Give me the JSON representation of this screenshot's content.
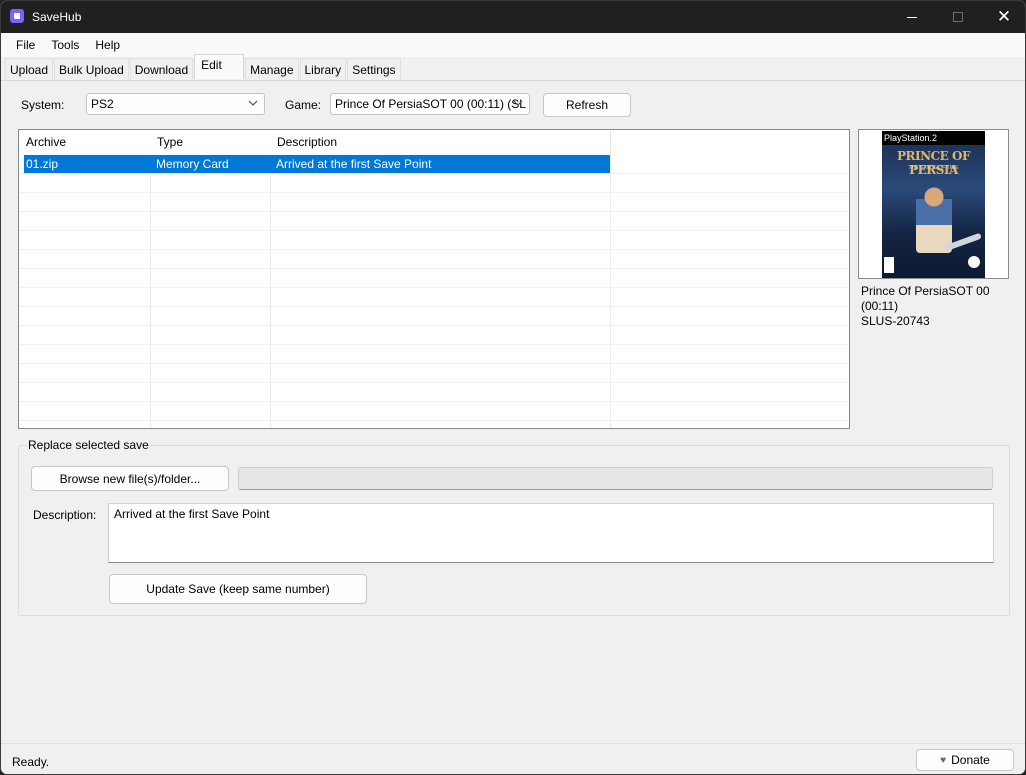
{
  "window": {
    "title": "SaveHub"
  },
  "menu": [
    "File",
    "Tools",
    "Help"
  ],
  "tabs": [
    "Upload",
    "Bulk Upload",
    "Download",
    "Edit",
    "Manage",
    "Library",
    "Settings"
  ],
  "active_tab": "Edit",
  "filters": {
    "system_label": "System:",
    "system_value": "PS2",
    "game_label": "Game:",
    "game_value": "Prince Of PersiaSOT 00 (00:11) (SL",
    "refresh_label": "Refresh"
  },
  "table": {
    "columns": [
      "Archive",
      "Type",
      "Description"
    ],
    "rows": [
      {
        "archive": "01.zip",
        "type": "Memory Card",
        "description": "Arrived at the first Save Point",
        "selected": true
      }
    ]
  },
  "cover": {
    "platform": "PlayStation.2",
    "logo_text": "PRINCE OF PERSIA",
    "subtitle": "THE SANDS OF TIME"
  },
  "game_info": {
    "name": "Prince Of PersiaSOT 00 (00:11)",
    "serial": "SLUS-20743"
  },
  "replace": {
    "group_title": "Replace selected save",
    "browse_label": "Browse new file(s)/folder...",
    "description_label": "Description:",
    "description_value": "Arrived at the first Save Point",
    "update_label": "Update Save (keep same number)",
    "progress": 0
  },
  "status": {
    "text": "Ready.",
    "donate_label": "Donate"
  },
  "colors": {
    "selection": "#0078d7",
    "titlebar": "#202020",
    "accent": "#7b61ff"
  }
}
